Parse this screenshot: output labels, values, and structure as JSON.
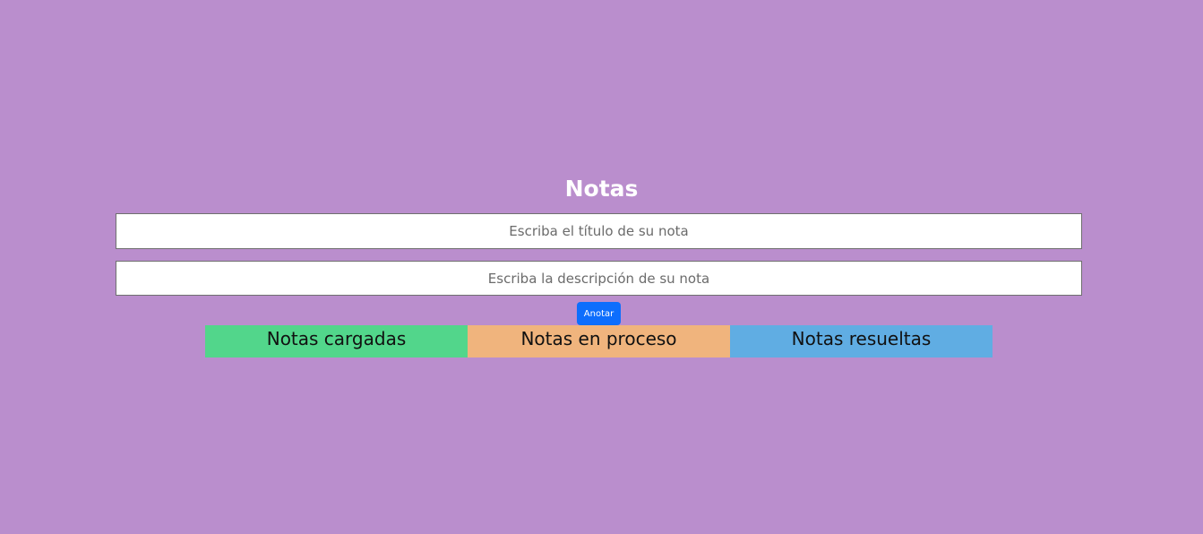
{
  "header": {
    "title": "Notas"
  },
  "form": {
    "title_placeholder": "Escriba el título de su nota",
    "description_placeholder": "Escriba la descripción de su nota",
    "submit_label": "Anotar"
  },
  "columns": [
    {
      "label": "Notas cargadas",
      "color": "#52d68b"
    },
    {
      "label": "Notas en proceso",
      "color": "#f0b47d"
    },
    {
      "label": "Notas resueltas",
      "color": "#60ade3"
    }
  ],
  "colors": {
    "background": "#ba8ecd",
    "button": "#0d6efd"
  }
}
